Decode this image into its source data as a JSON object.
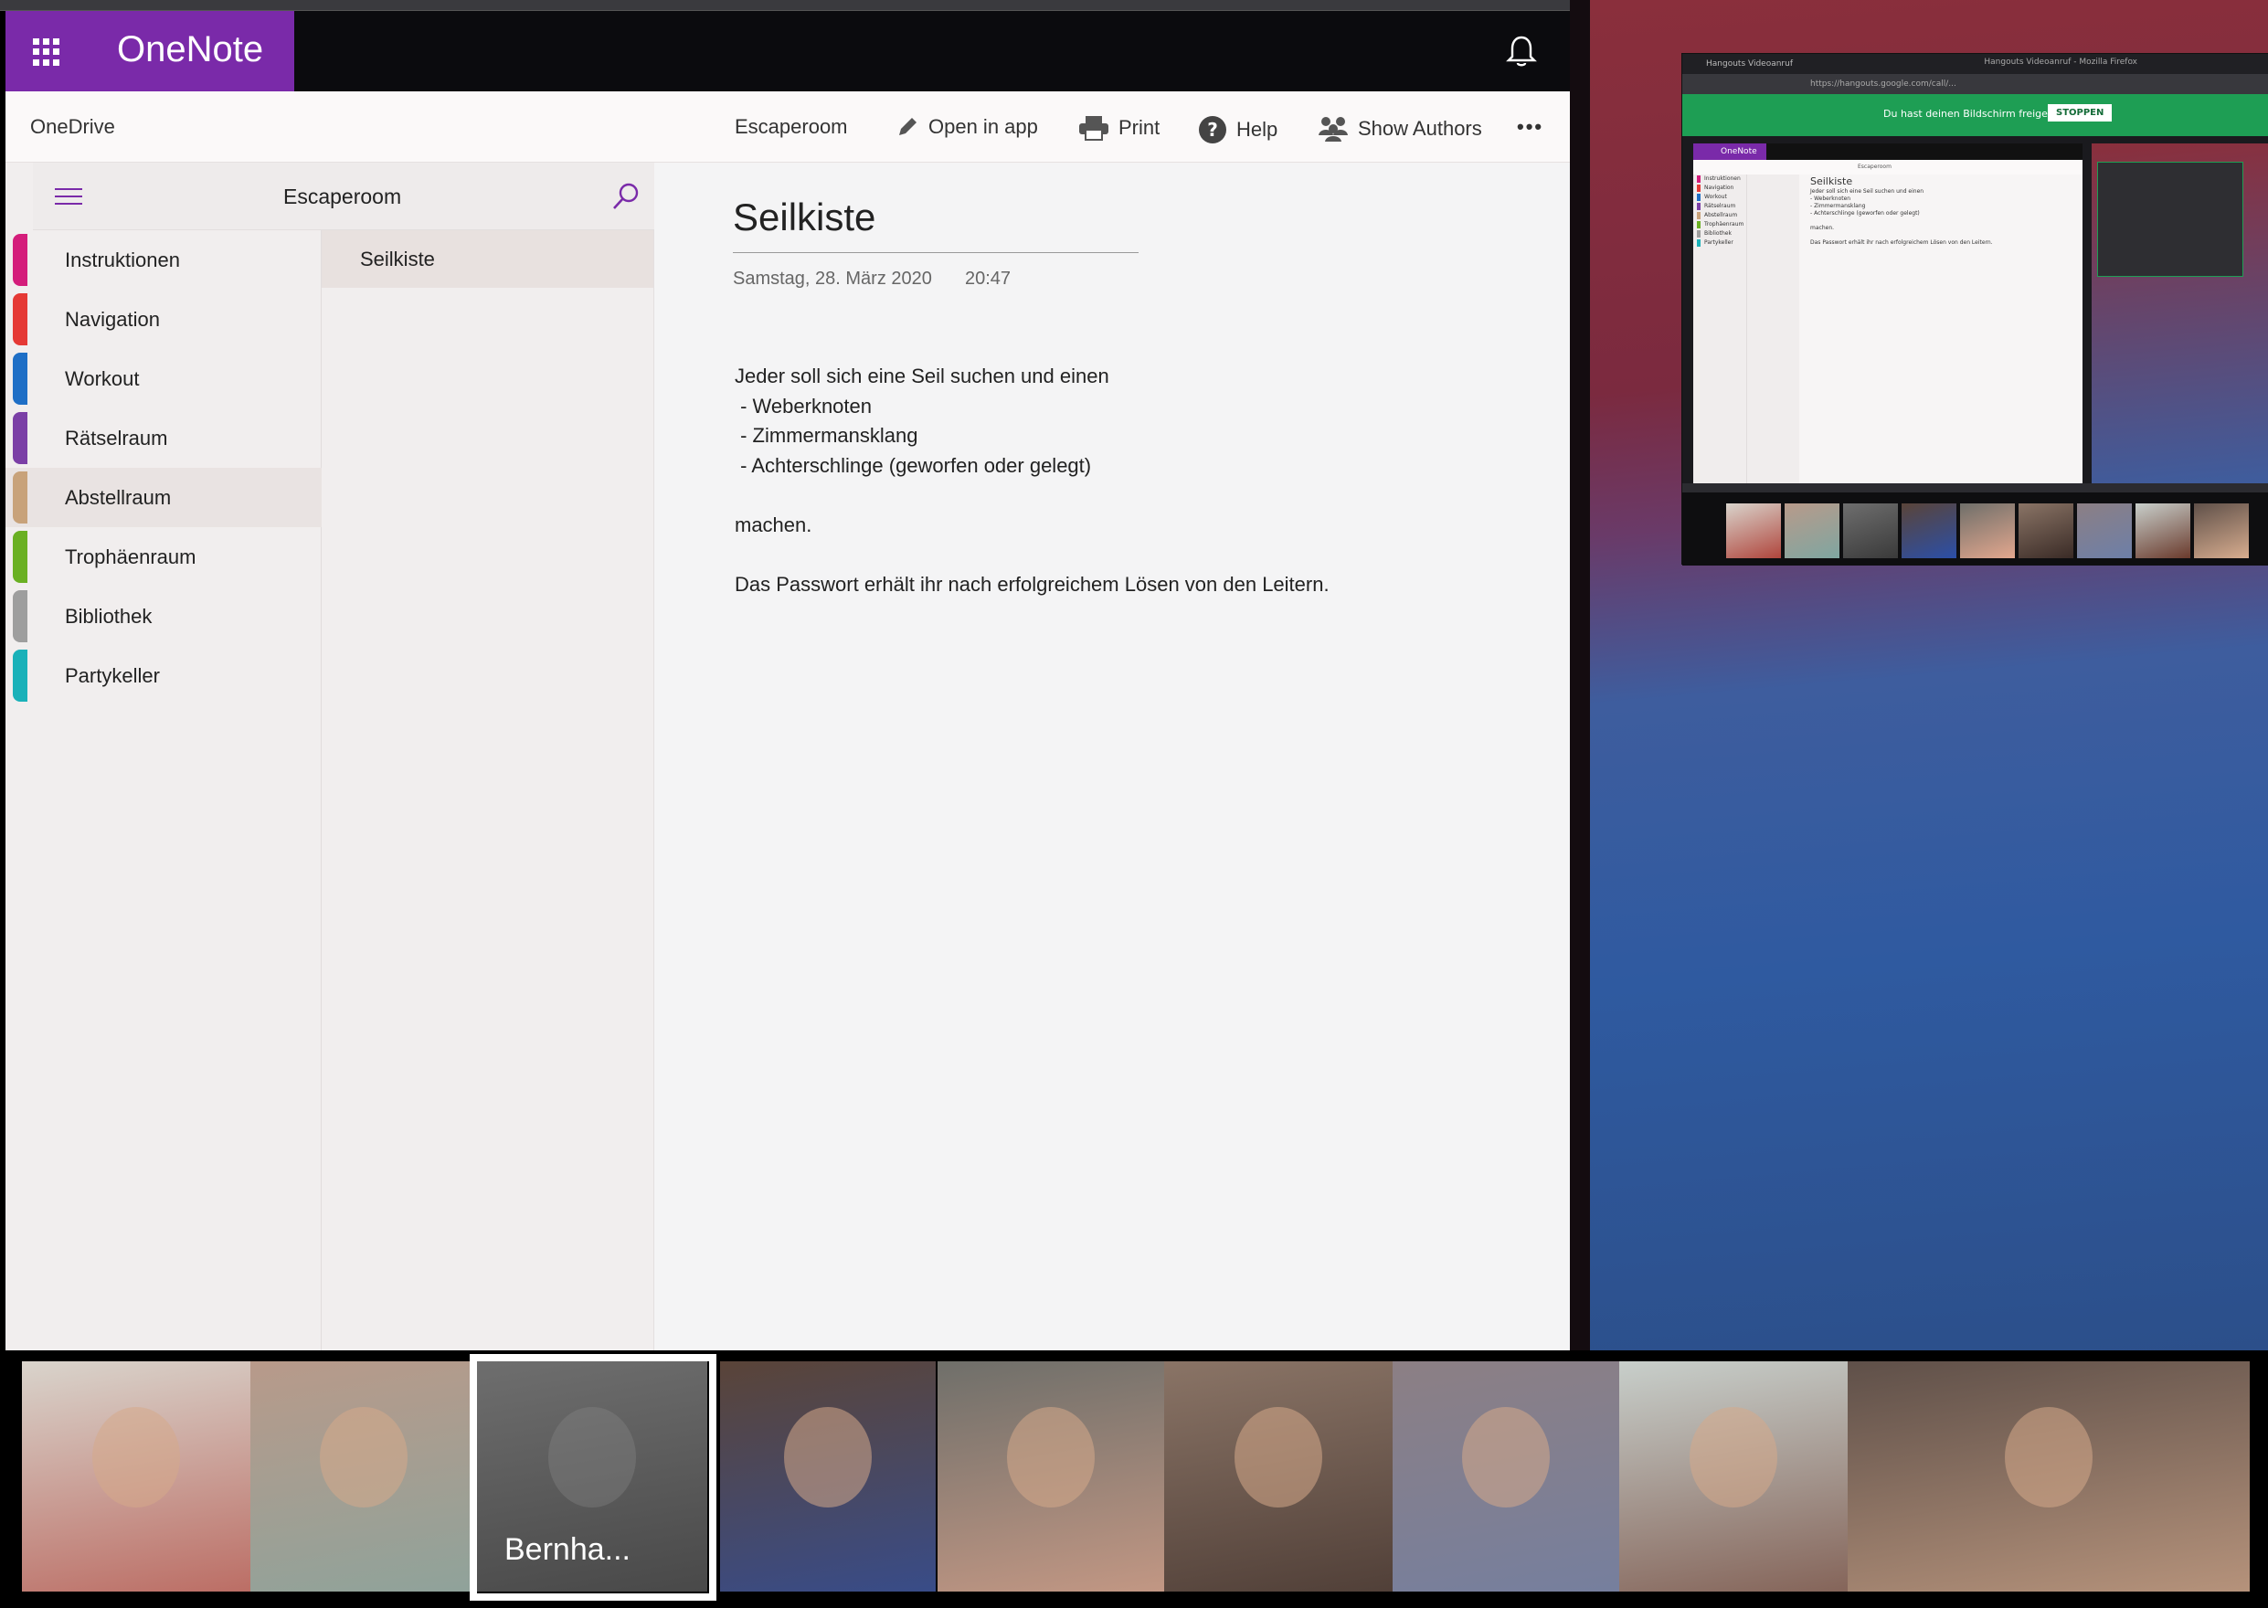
{
  "app": {
    "name": "OneNote",
    "accent": "#7a2aa9"
  },
  "commandbar": {
    "onedrive": "OneDrive",
    "notebook": "Escaperoom",
    "open_in_app": "Open in app",
    "print": "Print",
    "help": "Help",
    "show_authors": "Show Authors",
    "more": "•••"
  },
  "notebook": {
    "title": "Escaperoom",
    "sections": [
      {
        "label": "Instruktionen",
        "color": "#d41d7b"
      },
      {
        "label": "Navigation",
        "color": "#e53935"
      },
      {
        "label": "Workout",
        "color": "#1f6fc6"
      },
      {
        "label": "Rätselraum",
        "color": "#7b3fa6"
      },
      {
        "label": "Abstellraum",
        "color": "#c8a27a",
        "selected": true
      },
      {
        "label": "Trophäenraum",
        "color": "#6ab023"
      },
      {
        "label": "Bibliothek",
        "color": "#9e9e9e"
      },
      {
        "label": "Partykeller",
        "color": "#1ab1b9"
      }
    ],
    "pages": [
      {
        "label": "Seilkiste",
        "selected": true
      }
    ]
  },
  "page": {
    "title": "Seilkiste",
    "date": "Samstag, 28. März 2020",
    "time": "20:47",
    "body": [
      "Jeder soll sich eine Seil suchen und einen",
      " - Weberknoten",
      " - Zimmermansklang",
      " - Achterschlinge (geworfen oder gelegt)",
      "",
      "machen.",
      "",
      "Das Passwort erhält ihr nach erfolgreichem Lösen von den Leitern."
    ]
  },
  "shared_screen": {
    "window_title": "Hangouts Videoanruf - Mozilla Firefox",
    "tab_label": "Hangouts Videoanruf",
    "url": "https://hangouts.google.com/call/...",
    "banner_text": "Du hast deinen Bildschirm freigegeben.",
    "stop_button": "STOPPEN"
  },
  "participants": {
    "active_name": "Bernha...",
    "tiles": [
      {
        "bg": "#d9d4cc",
        "accent": "#b0453c"
      },
      {
        "bg": "#b89a8a",
        "accent": "#7fa6a1"
      },
      {
        "bg": "#6e6e6e",
        "accent": "#3a3a3a",
        "active": true
      },
      {
        "bg": "#5a4438",
        "accent": "#2b4fa8"
      },
      {
        "bg": "#6f6f6a",
        "accent": "#e3a78e"
      },
      {
        "bg": "#8a7466",
        "accent": "#3a2b26"
      },
      {
        "bg": "#8c7f84",
        "accent": "#6d7fa8"
      },
      {
        "bg": "#c8cfcb",
        "accent": "#6a3a2c"
      },
      {
        "bg": "#5f5049",
        "accent": "#d8ad8f"
      }
    ]
  }
}
